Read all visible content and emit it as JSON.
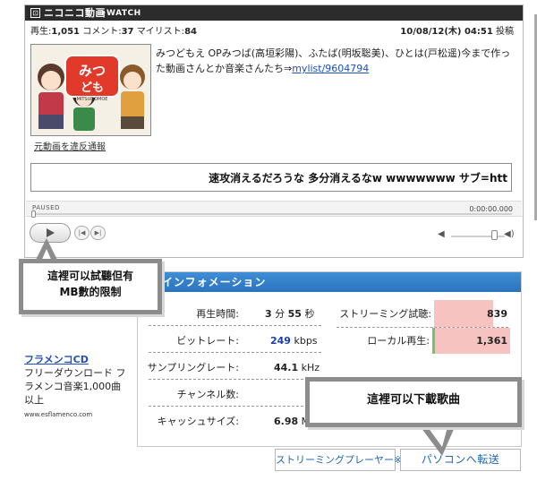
{
  "player": {
    "site_name": "ニコニコ動画",
    "watch_label": "+WATCH",
    "logo_glyph": "⊡",
    "stats": {
      "views_label": "再生:",
      "views": "1,051",
      "comments_label": "コメント:",
      "comments": "37",
      "mylist_label": "マイリスト:",
      "mylist": "84"
    },
    "post_date": "10/08/12(木) 04:51",
    "post_suffix": "投稿",
    "description": "みつどもえ OPみつば(高垣彩陽)、ふたば(明坂聡美)、ひとは(戸松遥)今まで作った動画さんとか音楽さんたち⇒",
    "description_link": "mylist/9604794",
    "thumbnail_logo": "みつどもえ",
    "thumbnail_sub": "MITSUDOMOE",
    "report_link": "元動画を違反通報",
    "comment_text": "速攻消えるだろうな 多分消えるなw wwwwwww サブ=htt",
    "status": "PAUSED",
    "time": "0:00:00.000",
    "prev_glyph": "|◀",
    "next_glyph": "▶|",
    "volume_glyph": "◀",
    "volume_max_glyph": "◀)"
  },
  "info": {
    "title": "インフォメーション",
    "rows_left": [
      {
        "label": "再生時間:",
        "value_parts": [
          "3",
          " 分 ",
          "55",
          " 秒"
        ]
      },
      {
        "label": "ビットレート:",
        "value": "249",
        "unit": " kbps"
      },
      {
        "label": "サンプリングレート:",
        "value": "44.1",
        "unit": " kHz"
      },
      {
        "label": "チャンネル数:",
        "value": ""
      },
      {
        "label": "キャッシュサイズ:",
        "value": "6.98",
        "unit": " M"
      }
    ],
    "rows_right": [
      {
        "label": "ストリーミング試聴:",
        "value": "839"
      },
      {
        "label": "ローカル再生:",
        "value": "1,361"
      }
    ]
  },
  "buttons": {
    "stream_player": "ストリーミングプレーヤー※",
    "transfer": "パソコンへ転送"
  },
  "left_ad": {
    "title": "フラメンコCD",
    "desc": "フリーダウンロード フラメンコ音楽1,000曲以上",
    "url": "www.esflamenco.com"
  },
  "callouts": {
    "preview": [
      "這裡可以試聽但有",
      "MB數的限制"
    ],
    "download": "這裡可以下載歌曲"
  },
  "colors": {
    "header_dark": "#2c2c2c",
    "info_blue": "#2b73bd",
    "pink_highlight": "#f6c3c0",
    "link_blue": "#1a4fc1",
    "bitrate_blue": "#1c3fae"
  }
}
